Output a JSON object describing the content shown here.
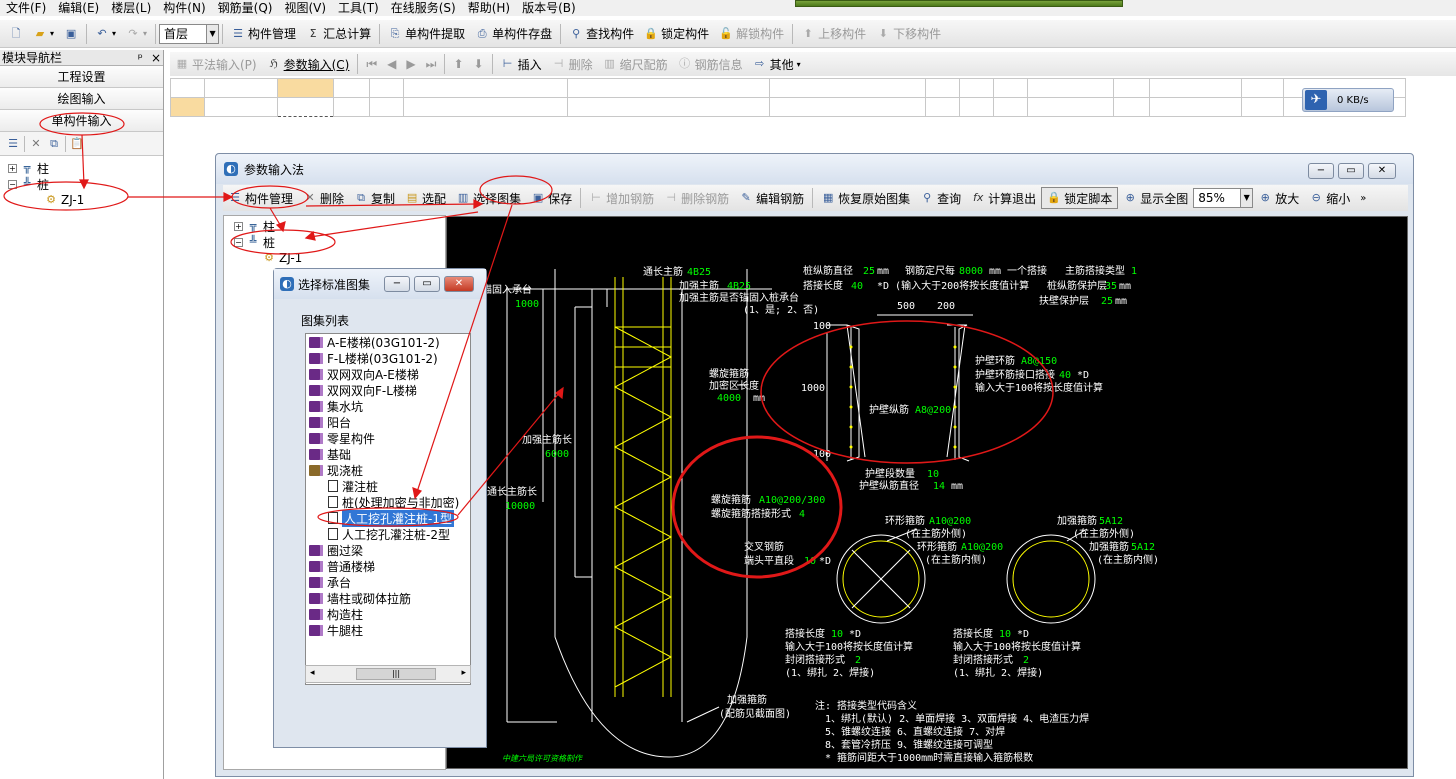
{
  "menu": [
    "文件(F)",
    "编辑(E)",
    "楼层(L)",
    "构件(N)",
    "钢筋量(Q)",
    "视图(V)",
    "工具(T)",
    "在线服务(S)",
    "帮助(H)",
    "版本号(B)"
  ],
  "toolbar1": {
    "floor_value": "首层",
    "component_mgmt": "构件管理",
    "sum_calc": "汇总计算",
    "single_extract": "单构件提取",
    "single_save": "单构件存盘",
    "find": "查找构件",
    "lock": "锁定构件",
    "unlock": "解锁构件",
    "move_up": "上移构件",
    "move_down": "下移构件"
  },
  "left_panel": {
    "title": "模块导航栏",
    "pin": "ᵖ",
    "close": "×",
    "nav_buttons": [
      "工程设置",
      "绘图输入",
      "单构件输入"
    ],
    "tree": {
      "item1": "柱",
      "item2": "桩",
      "child": "ZJ-1"
    }
  },
  "toolbar2": {
    "plain_input": "平法输入(P)",
    "param_input": "参数输入(C)",
    "insert": "插入",
    "delete": "删除",
    "scale_rebar": "缩尺配筋",
    "rebar_info": "钢筋信息",
    "other": "其他"
  },
  "network": {
    "speed": "0 KB/s"
  },
  "param_window": {
    "title": "参数输入法",
    "toolbar": {
      "component_mgmt": "构件管理",
      "delete": "删除",
      "copy": "复制",
      "select_match": "选配",
      "select_atlas": "选择图集",
      "save": "保存",
      "add_rebar": "增加钢筋",
      "del_rebar": "删除钢筋",
      "edit_rebar": "编辑钢筋",
      "restore": "恢复原始图集",
      "query": "查询",
      "calc_exit": "计算退出",
      "lock_script": "锁定脚本",
      "show_all": "显示全图",
      "zoom_value": "85%",
      "zoom_in": "放大",
      "zoom_out": "缩小"
    },
    "tree": {
      "item1": "柱",
      "item2": "桩",
      "child": "ZJ-1"
    }
  },
  "atlas_dialog": {
    "title": "选择标准图集",
    "list_label": "图集列表",
    "items": [
      {
        "label": "A-E楼梯(03G101-2)",
        "type": "book"
      },
      {
        "label": "F-L楼梯(03G101-2)",
        "type": "book"
      },
      {
        "label": "双网双向A-E楼梯",
        "type": "book"
      },
      {
        "label": "双网双向F-L楼梯",
        "type": "book"
      },
      {
        "label": "集水坑",
        "type": "book"
      },
      {
        "label": "阳台",
        "type": "book"
      },
      {
        "label": "零星构件",
        "type": "book"
      },
      {
        "label": "基础",
        "type": "book"
      },
      {
        "label": "现浇桩",
        "type": "openbook"
      },
      {
        "label": "灌注桩",
        "type": "doc"
      },
      {
        "label": "桩(处理加密与非加密)",
        "type": "doc"
      },
      {
        "label": "人工挖孔灌注桩-1型",
        "type": "doc-selected"
      },
      {
        "label": "人工挖孔灌注桩-2型",
        "type": "doc"
      },
      {
        "label": "圈过梁",
        "type": "book"
      },
      {
        "label": "普通楼梯",
        "type": "book"
      },
      {
        "label": "承台",
        "type": "book"
      },
      {
        "label": "墙柱或砌体拉筋",
        "type": "book"
      },
      {
        "label": "构造柱",
        "type": "book"
      },
      {
        "label": "牛腿柱",
        "type": "book"
      }
    ]
  },
  "drawing": {
    "t_anchor": "锚固入承台",
    "v_1000a": "1000",
    "t_long_top": "通长主筋",
    "t_long_top_v": "4B25",
    "t_add_main": "加强主筋",
    "t_add_main_v": "4B25",
    "t_anchor_q": "加强主筋是否锚固入桩承台",
    "t_anchor_opt": "(1、是; 2、否)",
    "t_spiral_dense": "螺旋箍筋",
    "t_spiral_dense2": "加密区长度",
    "v_4000": "4000",
    "u_mm": "mm",
    "t_add_len": "加强主筋长",
    "v_6000": "6000",
    "t_long_len": "通长主筋长",
    "v_10000": "10000",
    "t_spiral": "螺旋箍筋",
    "v_spiral": "A10@200/300",
    "t_spiral_lap": "螺旋箍筋搭接形式",
    "v_spiral_lap": "4",
    "t_cross": "交叉钢筋",
    "t_end_flat": "端头平直段",
    "v_end_flat": "10",
    "u_d": "*D",
    "t_add_stir": "加强箍筋",
    "t_add_stir2": "(配筋见截面图)",
    "t_bottom": "中建六局许可资格制作",
    "t_pile_dia": "桩纵筋直径",
    "v_pile_dia": "25",
    "t_rebar_len": "钢筋定尺每",
    "v_rebar_len": "8000",
    "t_one_lap": "mm 一个搭接",
    "t_main_lap_type": "主筋搭接类型",
    "v_main_lap_type": "1",
    "t_lap_len": "搭接长度",
    "v_lap_len": "40",
    "t_lap_note": "*D (输入大于200将按长度值计算",
    "t_cover": "桩纵筋保护层",
    "v_cover": "35",
    "t_cover2": "扶壁保护层",
    "v_cover2": "25",
    "v_500": "500",
    "v_200": "200",
    "v_100a": "100",
    "v_1000b": "1000",
    "v_100b": "100",
    "t_wall_ring": "护壁环筋",
    "v_wall_ring": "A8@150",
    "t_wall_lap": "护壁环筋接口搭接",
    "v_wall_lap": "40",
    "t_wall_note": "输入大于100将按长度值计算",
    "t_wall_long": "护壁纵筋",
    "v_wall_long": "A8@200",
    "t_wall_seg": "护壁段数量",
    "v_wall_seg": "10",
    "t_wall_dia": "护壁纵筋直径",
    "v_wall_dia": "14",
    "t_ring1": "环形箍筋",
    "v_ring1": "A10@200",
    "t_outer": "(在主筋外侧)",
    "t_ring2": "环形箍筋",
    "v_ring2": "A10@200",
    "t_inner": "(在主筋内侧)",
    "t_add_stir_b": "加强箍筋",
    "v_add_stir_b": "5A12",
    "t_outer_b": "(在主筋外侧)",
    "t_add_stir_c": "加强箍筋",
    "v_add_stir_c": "5A12",
    "t_inner_b": "(在主筋内侧)",
    "t_lap_len_a": "搭接长度",
    "v_lap_len_a": "10",
    "t_lap_calc_a": "输入大于100将按长度值计算",
    "t_close_a": "封闭搭接形式",
    "v_close_a": "2",
    "t_close_opt_a": "(1、绑扎  2、焊接)",
    "t_lap_len_b": "搭接长度",
    "v_lap_len_b": "10",
    "t_lap_calc_b": "输入大于100将按长度值计算",
    "t_close_b": "封闭搭接形式",
    "v_close_b": "2",
    "t_close_opt_b": "(1、绑扎  2、焊接)",
    "note_title": "注: 搭接类型代码含义",
    "note1": "1、绑扎(默认)   2、单面焊接   3、双面焊接   4、电渣压力焊",
    "note2": "5、锥螺纹连接   6、直螺纹连接   7、对焊",
    "note3": "8、套管冷挤压   9、锥螺纹连接可调型",
    "note4": "* 箍筋间距大于1000mm时需直接输入箍筋根数"
  }
}
